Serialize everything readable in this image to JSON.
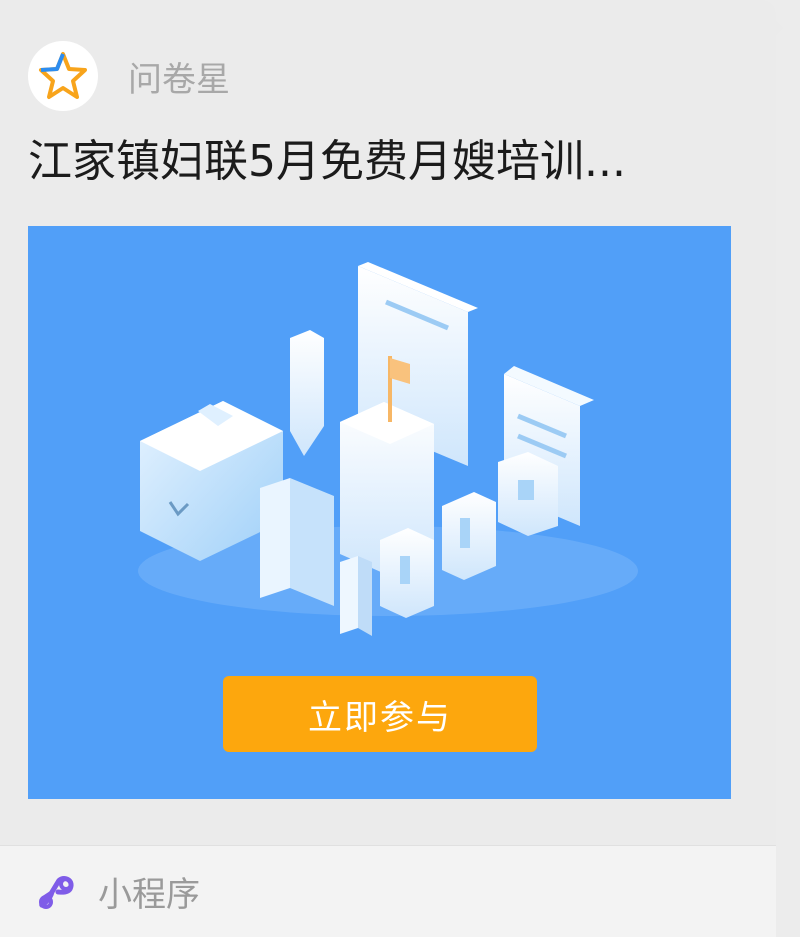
{
  "card": {
    "app_name": "问卷星",
    "app_logo_icon": "star-logo-icon",
    "title": "江家镇妇联5月免费月嫂培训...",
    "cta_label": "立即参与",
    "banner_illustration": "survey-isometric-illustration",
    "footer_icon": "mini-program-icon",
    "footer_label": "小程序"
  },
  "colors": {
    "banner_bg": "#519ff8",
    "cta_bg": "#fda70d",
    "star_orange": "#f8a41b",
    "star_blue": "#2d8df0",
    "mini_program_purple": "#7f5ce8"
  }
}
